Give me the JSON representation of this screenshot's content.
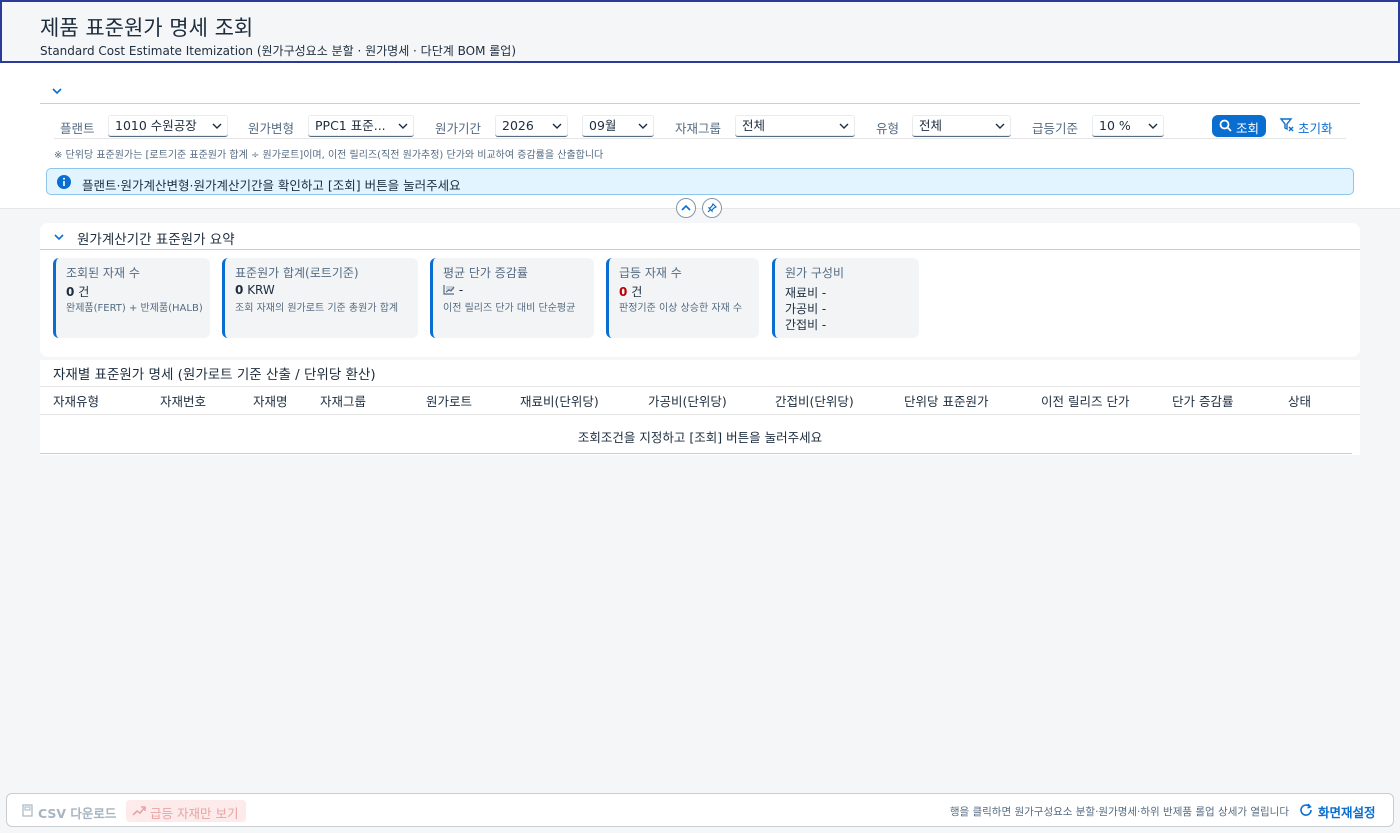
{
  "header": {
    "title": "제품 표준원가 명세 조회",
    "subtitle": "Standard Cost Estimate Itemization (원가구성요소 분할 · 원가명세 · 다단계 BOM 롤업)"
  },
  "filters": {
    "plant": {
      "label": "플랜트",
      "value": "1010 수원공장"
    },
    "variant": {
      "label": "원가변형",
      "value": "PPC1 표준..."
    },
    "period": {
      "label": "원가기간",
      "year": "2026",
      "month": "09월"
    },
    "material_group": {
      "label": "자재그룹",
      "value": "전체"
    },
    "type": {
      "label": "유형",
      "value": "전체"
    },
    "surge": {
      "label": "급등기준",
      "value": "10 %"
    },
    "search_label": "조회",
    "reset_label": "초기화",
    "note": "※ 단위당 표준원가는 [로트기준 표준원가 합계 ÷ 원가로트]이며, 이전 릴리즈(직전 원가추정) 단가와 비교하여 증감률을 산출합니다"
  },
  "info": {
    "message": "플랜트·원가계산변형·원가계산기간을 확인하고 [조회] 버튼을 눌러주세요"
  },
  "summary": {
    "title": "원가계산기간 표준원가 요약",
    "cards": [
      {
        "title": "조회된 자재 수",
        "value": "0",
        "unit": "건",
        "sub": "완제품(FERT) + 반제품(HALB)"
      },
      {
        "title": "표준원가 합계(로트기준)",
        "value": "0",
        "unit": "KRW",
        "sub": "조회 자재의 원가로트 기준 총원가 합계"
      },
      {
        "title": "평균 단가 증감률",
        "value": "-",
        "unit": "",
        "sub": "이전 릴리즈 단가 대비 단순평균"
      },
      {
        "title": "급등 자재 수",
        "value": "0",
        "unit": "건",
        "sub": "판정기준 이상 상승한 자재 수"
      },
      {
        "title": "원가 구성비",
        "rows": [
          "재료비 -",
          "가공비 -",
          "간접비 -"
        ]
      }
    ]
  },
  "detail": {
    "title": "자재별 표준원가 명세 (원가로트 기준 산출 / 단위당 환산)",
    "columns": [
      "자재유형",
      "자재번호",
      "자재명",
      "자재그룹",
      "원가로트",
      "재료비(단위당)",
      "가공비(단위당)",
      "간접비(단위당)",
      "단위당 표준원가",
      "이전 릴리즈 단가",
      "단가 증감률",
      "상태"
    ],
    "empty_message": "조회조건을 지정하고 [조회] 버튼을 눌러주세요"
  },
  "footer": {
    "csv_label": "CSV 다운로드",
    "surge_only_label": "급등 자재만 보기",
    "hint": "행을 클릭하면 원가구성요소 분할·원가명세·하위 반제품 롤업 상세가 열립니다",
    "reset_layout_label": "화면재설정"
  },
  "colors": {
    "accent": "#0a6ed1",
    "header_border": "#2a3b9c",
    "alert_red": "#bb0000"
  }
}
